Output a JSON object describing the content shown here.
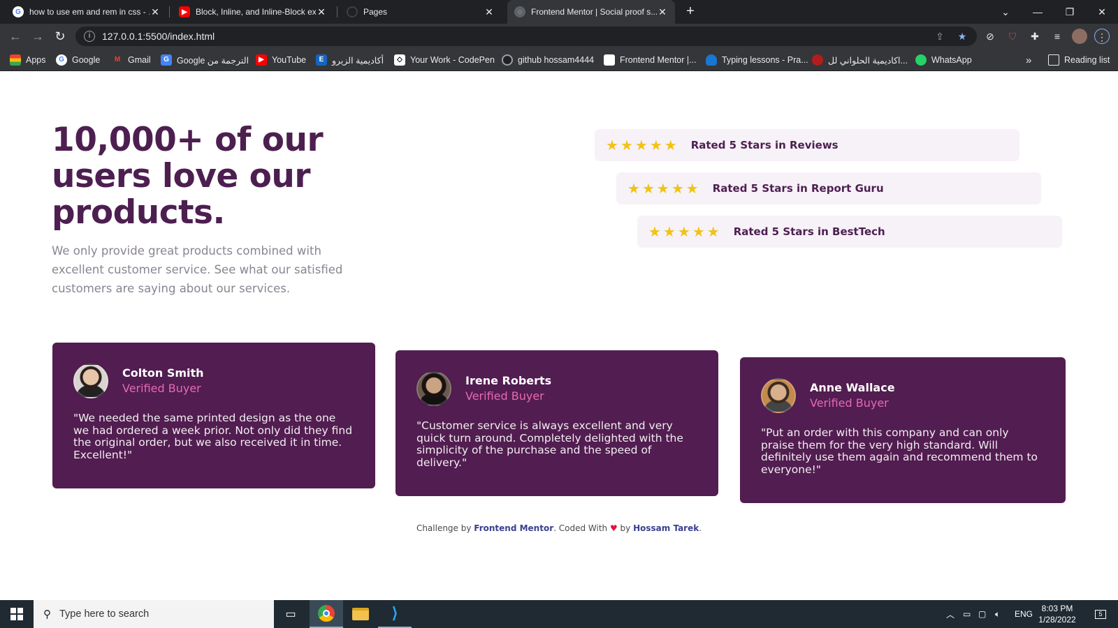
{
  "browser": {
    "tabs": [
      {
        "title": "how to use em and rem in css - ..."
      },
      {
        "title": "Block, Inline, and Inline-Block exp"
      },
      {
        "title": "Pages"
      },
      {
        "title": "Frontend Mentor | Social proof s..."
      }
    ],
    "url": "127.0.0.1:5500/index.html",
    "bookmarks": [
      {
        "label": "Apps"
      },
      {
        "label": "Google"
      },
      {
        "label": "Gmail"
      },
      {
        "label": "Google الترجمة من"
      },
      {
        "label": "YouTube"
      },
      {
        "label": "أكاديمية الزيرو"
      },
      {
        "label": "Your Work - CodePen"
      },
      {
        "label": "github hossam4444"
      },
      {
        "label": "Frontend Mentor |..."
      },
      {
        "label": "Typing lessons - Pra..."
      },
      {
        "label": "اكاديمية الحلواني لل..."
      },
      {
        "label": "WhatsApp"
      }
    ],
    "reading_list": "Reading list",
    "more_bookmarks": "»"
  },
  "hero": {
    "title": "10,000+ of our users love our products.",
    "text": "We only provide great products combined with excellent customer service. See what our satisfied customers are saying about our services."
  },
  "ratings": [
    {
      "label": "Rated 5 Stars in Reviews",
      "stars": 5
    },
    {
      "label": "Rated 5 Stars in Report Guru",
      "stars": 5
    },
    {
      "label": "Rated 5 Stars in BestTech",
      "stars": 5
    }
  ],
  "testimonials": [
    {
      "name": "Colton Smith",
      "role": "Verified Buyer",
      "quote": "\"We needed the same printed design as the one we had ordered a week prior. Not only did they find the original order, but we also received it in time. Excellent!\""
    },
    {
      "name": "Irene Roberts",
      "role": "Verified Buyer",
      "quote": "\"Customer service is always excellent and very quick turn around. Completely delighted with the simplicity of the purchase and the speed of delivery.\""
    },
    {
      "name": "Anne Wallace",
      "role": "Verified Buyer",
      "quote": "\"Put an order with this company and can only praise them for the very high standard. Will definitely use them again and recommend them to everyone!\""
    }
  ],
  "footer": {
    "prefix": "Challenge by ",
    "mentor": "Frontend Mentor",
    "middle": ". Coded With ",
    "heart": "♥",
    "by": " by ",
    "author": "Hossam Tarek",
    "suffix": "."
  },
  "taskbar": {
    "search_placeholder": "Type here to search",
    "language": "ENG",
    "time": "8:03 PM",
    "date": "1/28/2022",
    "notifications": "5"
  },
  "colors": {
    "primary": "#521d50",
    "accent_pink": "#e56ab3",
    "star": "#f0c315",
    "rating_bg": "#f7f1f8"
  }
}
